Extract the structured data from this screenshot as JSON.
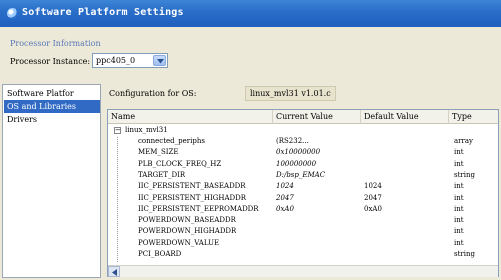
{
  "window": {
    "title": "Software Platform Settings",
    "icon": "app-icon"
  },
  "processor": {
    "heading": "Processor Information",
    "instance_label": "Processor Instance:",
    "instance_value": "ppc405_0"
  },
  "nav": {
    "items": [
      {
        "label": "Software Platfor",
        "selected": false
      },
      {
        "label": "OS and Libraries",
        "selected": true
      },
      {
        "label": "Drivers",
        "selected": false
      }
    ]
  },
  "config": {
    "label": "Configuration for OS:",
    "os_name": "linux_mvl31 v1.01.c"
  },
  "table": {
    "headers": [
      "Name",
      "Current Value",
      "Default Value",
      "Type"
    ],
    "root": "linux_mvl31",
    "rows": [
      {
        "name": "connected_periphs",
        "current": "(RS232...",
        "default": "",
        "type": "array"
      },
      {
        "name": "MEM_SIZE",
        "current": "0x10000000",
        "default": "",
        "type": "int"
      },
      {
        "name": "PLB_CLOCK_FREQ_HZ",
        "current": "100000000",
        "default": "",
        "type": "int"
      },
      {
        "name": "TARGET_DIR",
        "current": "D:/bsp_EMAC",
        "default": "",
        "type": "string"
      },
      {
        "name": "IIC_PERSISTENT_BASEADDR",
        "current": "1024",
        "default": "1024",
        "type": "int"
      },
      {
        "name": "IIC_PERSISTENT_HIGHADDR",
        "current": "2047",
        "default": "2047",
        "type": "int"
      },
      {
        "name": "IIC_PERSISTENT_EEPROMADDR",
        "current": "0xA0",
        "default": "0xA0",
        "type": "int"
      },
      {
        "name": "POWERDOWN_BASEADDR",
        "current": "",
        "default": "",
        "type": "int"
      },
      {
        "name": "POWERDOWN_HIGHADDR",
        "current": "",
        "default": "",
        "type": "int"
      },
      {
        "name": "POWERDOWN_VALUE",
        "current": "",
        "default": "",
        "type": "int"
      },
      {
        "name": "PCI_BOARD",
        "current": "",
        "default": "",
        "type": "string"
      }
    ]
  },
  "colors": {
    "title_bar": "#2a6fc9",
    "selection": "#316ac5",
    "section_heading": "#5a78b8"
  }
}
